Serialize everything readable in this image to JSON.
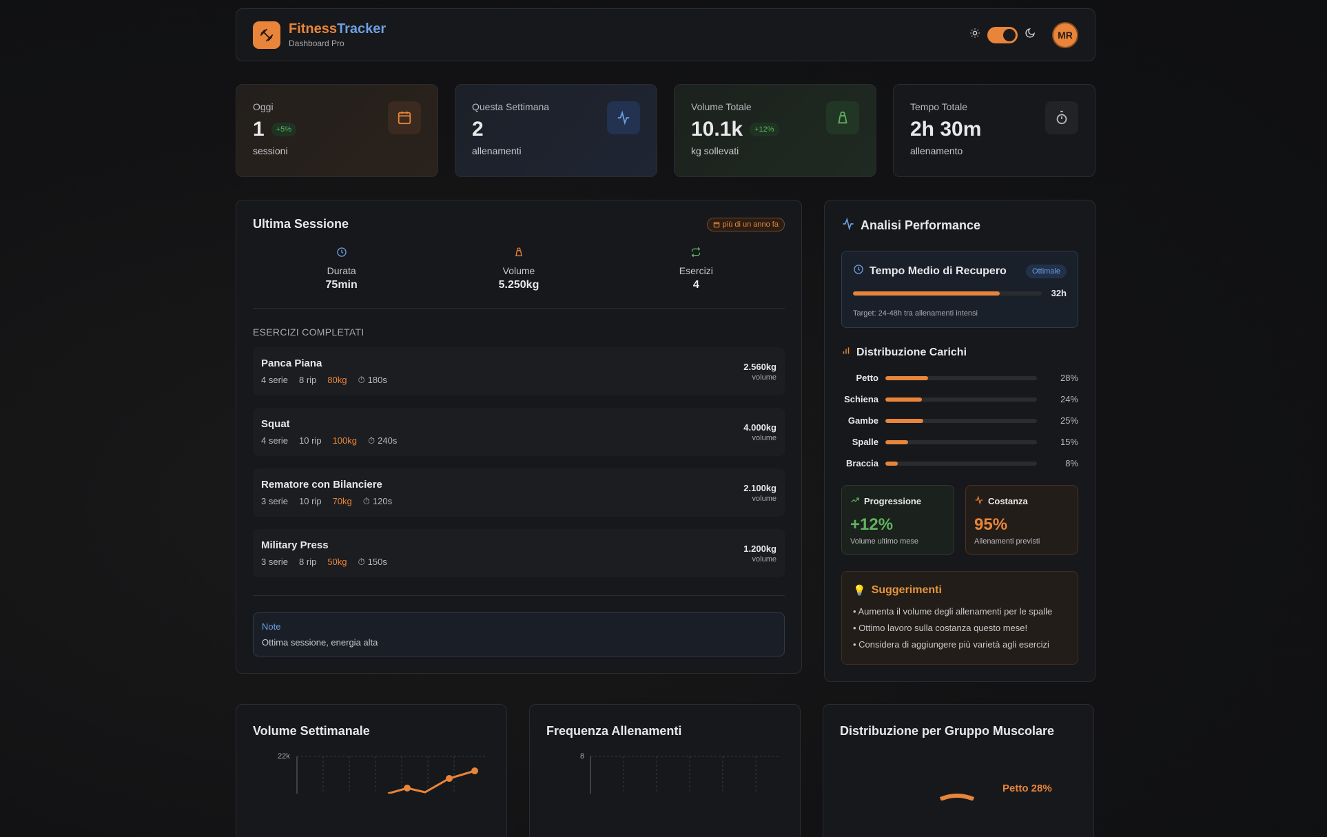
{
  "header": {
    "brand_a": "Fitness",
    "brand_b": "Tracker",
    "subtitle": "Dashboard Pro",
    "avatar": "MR",
    "theme_icons": [
      "sun-icon",
      "moon-icon"
    ]
  },
  "stats": [
    {
      "label": "Oggi",
      "value": "1",
      "change": "+5%",
      "sub": "sessioni",
      "icon": "calendar-icon"
    },
    {
      "label": "Questa Settimana",
      "value": "2",
      "change": "",
      "sub": "allenamenti",
      "icon": "activity-icon"
    },
    {
      "label": "Volume Totale",
      "value": "10.1k",
      "change": "+12%",
      "sub": "kg sollevati",
      "icon": "weight-icon"
    },
    {
      "label": "Tempo Totale",
      "value": "2h 30m",
      "change": "",
      "sub": "allenamento",
      "icon": "timer-icon"
    }
  ],
  "session": {
    "title": "Ultima Sessione",
    "badge": "più di un anno fa",
    "kpis": [
      {
        "label": "Durata",
        "value": "75min",
        "icon": "clock-icon"
      },
      {
        "label": "Volume",
        "value": "5.250kg",
        "icon": "weight-icon"
      },
      {
        "label": "Esercizi",
        "value": "4",
        "icon": "repeat-icon"
      }
    ],
    "exercises_heading": "ESERCIZI COMPLETATI",
    "exercises": [
      {
        "name": "Panca Piana",
        "sets": "4 serie",
        "reps": "8 rip",
        "weight": "80kg",
        "rest": "180s",
        "volume": "2.560kg",
        "volume_label": "volume"
      },
      {
        "name": "Squat",
        "sets": "4 serie",
        "reps": "10 rip",
        "weight": "100kg",
        "rest": "240s",
        "volume": "4.000kg",
        "volume_label": "volume"
      },
      {
        "name": "Rematore con Bilanciere",
        "sets": "3 serie",
        "reps": "10 rip",
        "weight": "70kg",
        "rest": "120s",
        "volume": "2.100kg",
        "volume_label": "volume"
      },
      {
        "name": "Military Press",
        "sets": "3 serie",
        "reps": "8 rip",
        "weight": "50kg",
        "rest": "150s",
        "volume": "1.200kg",
        "volume_label": "volume"
      }
    ],
    "note_title": "Note",
    "note_body": "Ottima sessione, energia alta"
  },
  "performance": {
    "title": "Analisi Performance",
    "recovery": {
      "title": "Tempo Medio di Recupero",
      "badge": "Ottimale",
      "value": "32h",
      "progress": 0.78,
      "target": "Target: 24-48h tra allenamenti intensi"
    },
    "distribution_title": "Distribuzione Carichi",
    "distribution": [
      {
        "name": "Petto",
        "pct": "28%",
        "value": 28
      },
      {
        "name": "Schiena",
        "pct": "24%",
        "value": 24
      },
      {
        "name": "Gambe",
        "pct": "25%",
        "value": 25
      },
      {
        "name": "Spalle",
        "pct": "15%",
        "value": 15
      },
      {
        "name": "Braccia",
        "pct": "8%",
        "value": 8
      }
    ],
    "progression": {
      "title": "Progressione",
      "value": "+12%",
      "sub": "Volume ultimo mese"
    },
    "consistency": {
      "title": "Costanza",
      "value": "95%",
      "sub": "Allenamenti previsti"
    },
    "suggestions_title": "Suggerimenti",
    "suggestions": [
      "• Aumenta il volume degli allenamenti per le spalle",
      "• Ottimo lavoro sulla costanza questo mese!",
      "• Considera di aggiungere più varietà agli esercizi"
    ]
  },
  "bottom": {
    "weekly_title": "Volume Settimanale",
    "weekly_ytick": "22k",
    "frequency_title": "Frequenza Allenamenti",
    "frequency_ytick": "8",
    "muscle_title": "Distribuzione per Gruppo Muscolare",
    "muscle_label": "Petto 28%"
  },
  "colors": {
    "accent": "#e8853a",
    "blue": "#6d9fe0",
    "green": "#5fb35f"
  }
}
